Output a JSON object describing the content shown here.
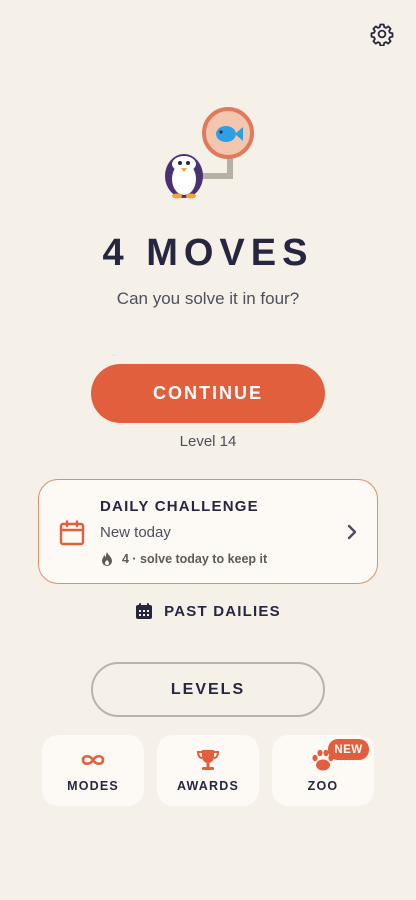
{
  "header": {
    "settings_icon": "gear-icon"
  },
  "hero": {
    "icons": [
      "penguin-icon",
      "fish-icon"
    ]
  },
  "title": "4 MOVES",
  "subtitle": "Can you solve it in four?",
  "continue_label": "CONTINUE",
  "level_text": "Level 14",
  "daily": {
    "title": "DAILY CHALLENGE",
    "subtitle": "New today",
    "streak_text": "4 · solve today to keep it",
    "icons": [
      "calendar-icon",
      "flame-icon",
      "chevron-right-icon"
    ]
  },
  "past_dailies_label": "PAST DAILIES",
  "levels_label": "LEVELS",
  "tiles": [
    {
      "label": "MODES",
      "icon": "infinity-icon"
    },
    {
      "label": "AWARDS",
      "icon": "trophy-icon"
    },
    {
      "label": "ZOO",
      "icon": "paw-icon",
      "badge": "NEW"
    }
  ],
  "colors": {
    "background": "#f5f0e8",
    "accent": "#e25f3e",
    "text_dark": "#272640",
    "text_muted": "#4f4e5c",
    "card": "#fdfaf5",
    "fish": "#2e9fe0"
  }
}
